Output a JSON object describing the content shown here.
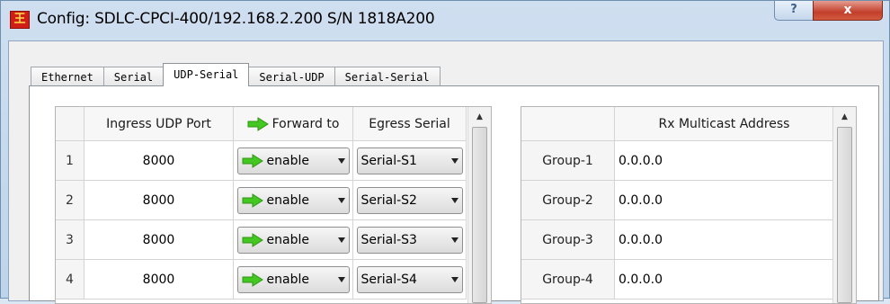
{
  "window": {
    "title": "Config: SDLC-CPCI-400/192.168.2.200 S/N 1818A200",
    "help_label": "?",
    "close_label": "x"
  },
  "tabs": [
    {
      "label": "Ethernet",
      "active": false
    },
    {
      "label": "Serial",
      "active": false
    },
    {
      "label": "UDP-Serial",
      "active": true
    },
    {
      "label": "Serial-UDP",
      "active": false
    },
    {
      "label": "Serial-Serial",
      "active": false
    }
  ],
  "udp_table": {
    "headers": {
      "index": "",
      "port": "Ingress UDP Port",
      "forward": "Forward to",
      "egress": "Egress Serial"
    },
    "rows": [
      {
        "index": "1",
        "port": "8000",
        "forward": "enable",
        "egress": "Serial-S1"
      },
      {
        "index": "2",
        "port": "8000",
        "forward": "enable",
        "egress": "Serial-S2"
      },
      {
        "index": "3",
        "port": "8000",
        "forward": "enable",
        "egress": "Serial-S3"
      },
      {
        "index": "4",
        "port": "8000",
        "forward": "enable",
        "egress": "Serial-S4"
      }
    ]
  },
  "multicast_table": {
    "headers": {
      "group": "",
      "address": "Rx Multicast Address"
    },
    "rows": [
      {
        "group": "Group-1",
        "address": "0.0.0.0"
      },
      {
        "group": "Group-2",
        "address": "0.0.0.0"
      },
      {
        "group": "Group-3",
        "address": "0.0.0.0"
      },
      {
        "group": "Group-4",
        "address": "0.0.0.0"
      }
    ]
  },
  "colors": {
    "forward_arrow": "#42c820",
    "close_button": "#c8452f",
    "title_icon": "#d01e17"
  },
  "icons": {
    "forward": "green-right-arrow-icon",
    "app": "app-logo-icon"
  }
}
